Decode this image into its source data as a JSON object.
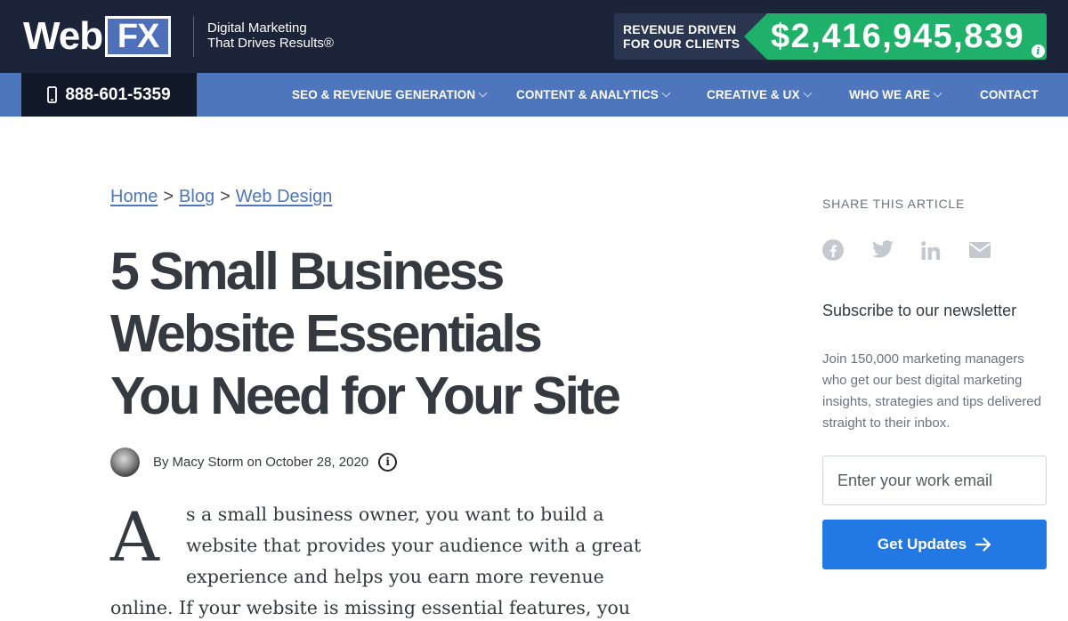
{
  "header": {
    "logo_web": "Web",
    "logo_fx": "FX",
    "tagline_line1": "Digital Marketing",
    "tagline_line2": "That Drives Results®",
    "revenue_label_line1": "REVENUE DRIVEN",
    "revenue_label_line2": "FOR OUR CLIENTS",
    "revenue_value": "$2,416,945,839",
    "info_icon": "i"
  },
  "nav": {
    "phone": "888-601-5359",
    "items": [
      {
        "label": "SEO & REVENUE GENERATION",
        "has_dropdown": true
      },
      {
        "label": "CONTENT & ANALYTICS",
        "has_dropdown": true
      },
      {
        "label": "CREATIVE & UX",
        "has_dropdown": true
      },
      {
        "label": "WHO WE ARE",
        "has_dropdown": true
      },
      {
        "label": "CONTACT",
        "has_dropdown": false
      }
    ]
  },
  "breadcrumb": {
    "home": "Home",
    "blog": "Blog",
    "category": "Web Design",
    "separator": ">"
  },
  "article": {
    "title_line1": "5 Small Business",
    "title_line2": "Website Essentials",
    "title_line3": "You Need for Your Site",
    "by": "By",
    "author": "Macy Storm",
    "on": "on",
    "date": "October 28, 2020",
    "dropcap": "A",
    "body_lines": [
      "s a small business owner, you want to build a",
      "website that provides your audience with a great",
      "experience and helps you earn more revenue",
      "online.  If your website is missing essential features, you"
    ]
  },
  "sidebar": {
    "share_title": "SHARE THIS ARTICLE",
    "share_icons": [
      "facebook-icon",
      "twitter-icon",
      "linkedin-icon",
      "email-icon"
    ],
    "newsletter_title": "Subscribe to our newsletter",
    "newsletter_desc": "Join 150,000 marketing managers who get our best digital marketing insights, strategies and tips delivered straight to their inbox.",
    "email_placeholder": "Enter your work email",
    "button_label": "Get Updates"
  },
  "colors": {
    "header_bg": "#1b2438",
    "nav_bg": "#4e76bd",
    "revenue_green": "#1fb06a",
    "link_blue": "#4e76bd",
    "button_blue": "#2279e3",
    "text_dark": "#343a40"
  }
}
